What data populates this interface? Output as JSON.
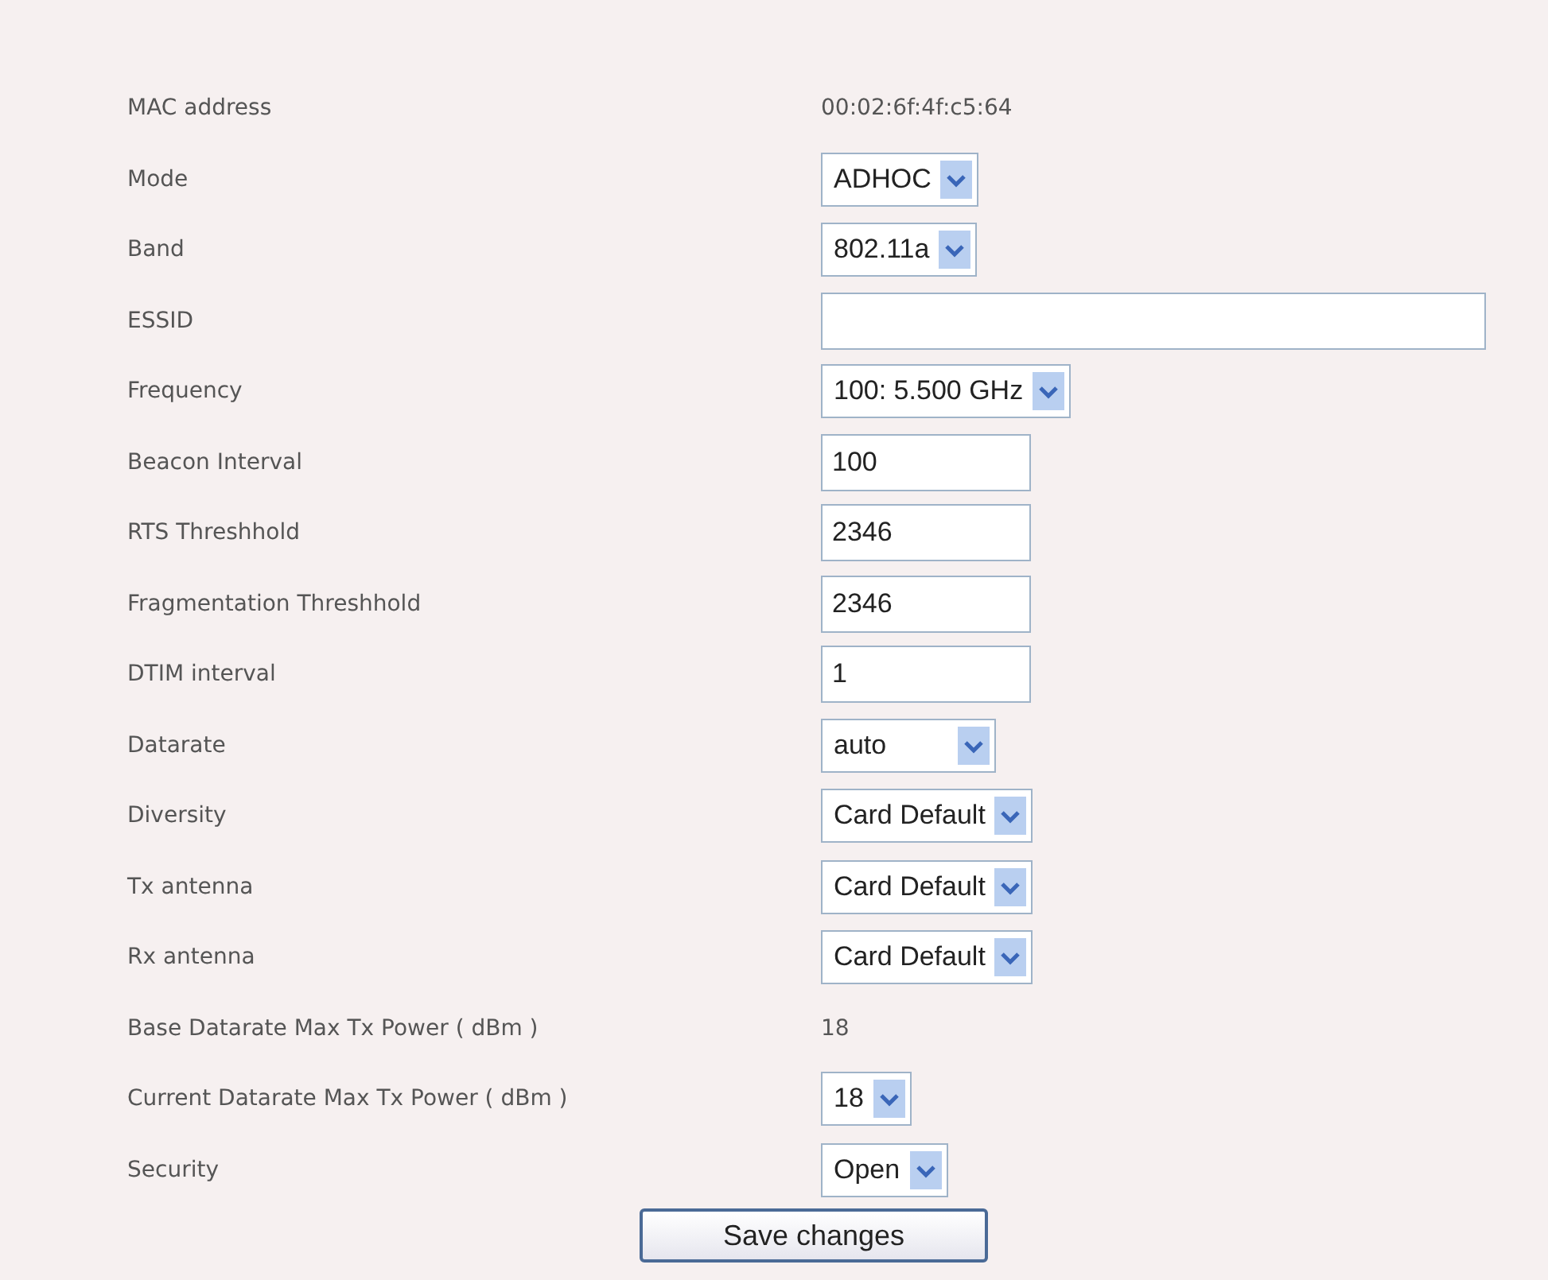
{
  "settings": [
    {
      "label": "MAC address",
      "kind": "text",
      "value": "00:02:6f:4f:c5:64"
    },
    {
      "label": "Mode",
      "kind": "select",
      "value": "ADHOC"
    },
    {
      "label": "Band",
      "kind": "select",
      "value": "802.11a"
    },
    {
      "label": "ESSID",
      "kind": "wide_input"
    },
    {
      "label": "Frequency",
      "kind": "select",
      "value": "100: 5.500 GHz"
    },
    {
      "label": "Beacon Interval",
      "kind": "input",
      "value": "100"
    },
    {
      "label": "RTS Threshhold",
      "kind": "input",
      "value": "2346"
    },
    {
      "label": "Fragmentation Threshhold",
      "kind": "input",
      "value": "2346"
    },
    {
      "label": "DTIM interval",
      "kind": "input",
      "value": "1"
    },
    {
      "label": "Datarate",
      "kind": "padded_select",
      "value": "auto"
    },
    {
      "label": "Diversity",
      "kind": "select",
      "value": "Card Default"
    },
    {
      "label": "Tx antenna",
      "kind": "select",
      "value": "Card Default"
    },
    {
      "label": "Rx antenna",
      "kind": "select",
      "value": "Card Default"
    },
    {
      "label": "Base Datarate Max Tx Power ( dBm )",
      "kind": "text",
      "value": "18"
    },
    {
      "label": "Current Datarate Max Tx Power ( dBm )",
      "kind": "select",
      "value": "18"
    },
    {
      "label": "Security",
      "kind": "select",
      "value": "Open"
    }
  ],
  "save_button": "Save changes"
}
